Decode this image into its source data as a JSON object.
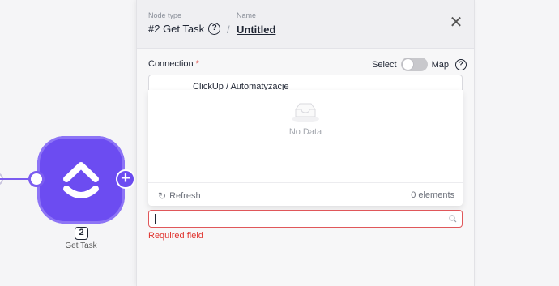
{
  "canvas": {
    "node": {
      "number": "2",
      "label": "Get Task",
      "color": "#6c4cf1"
    }
  },
  "panel": {
    "header": {
      "node_type_label": "Node type",
      "node_type": "#2 Get Task",
      "name_label": "Name",
      "name": "Untitled",
      "separator": "/"
    },
    "connection": {
      "label": "Connection",
      "required_mark": "*",
      "toggle_left": "Select",
      "toggle_right": "Map",
      "selected_value": "ClickUp / Automatyzacje"
    },
    "dropdown": {
      "empty_text": "No Data",
      "refresh_label": "Refresh",
      "count_text": "0 elements"
    },
    "search": {
      "value": "",
      "placeholder": ""
    },
    "error": "Required field"
  }
}
